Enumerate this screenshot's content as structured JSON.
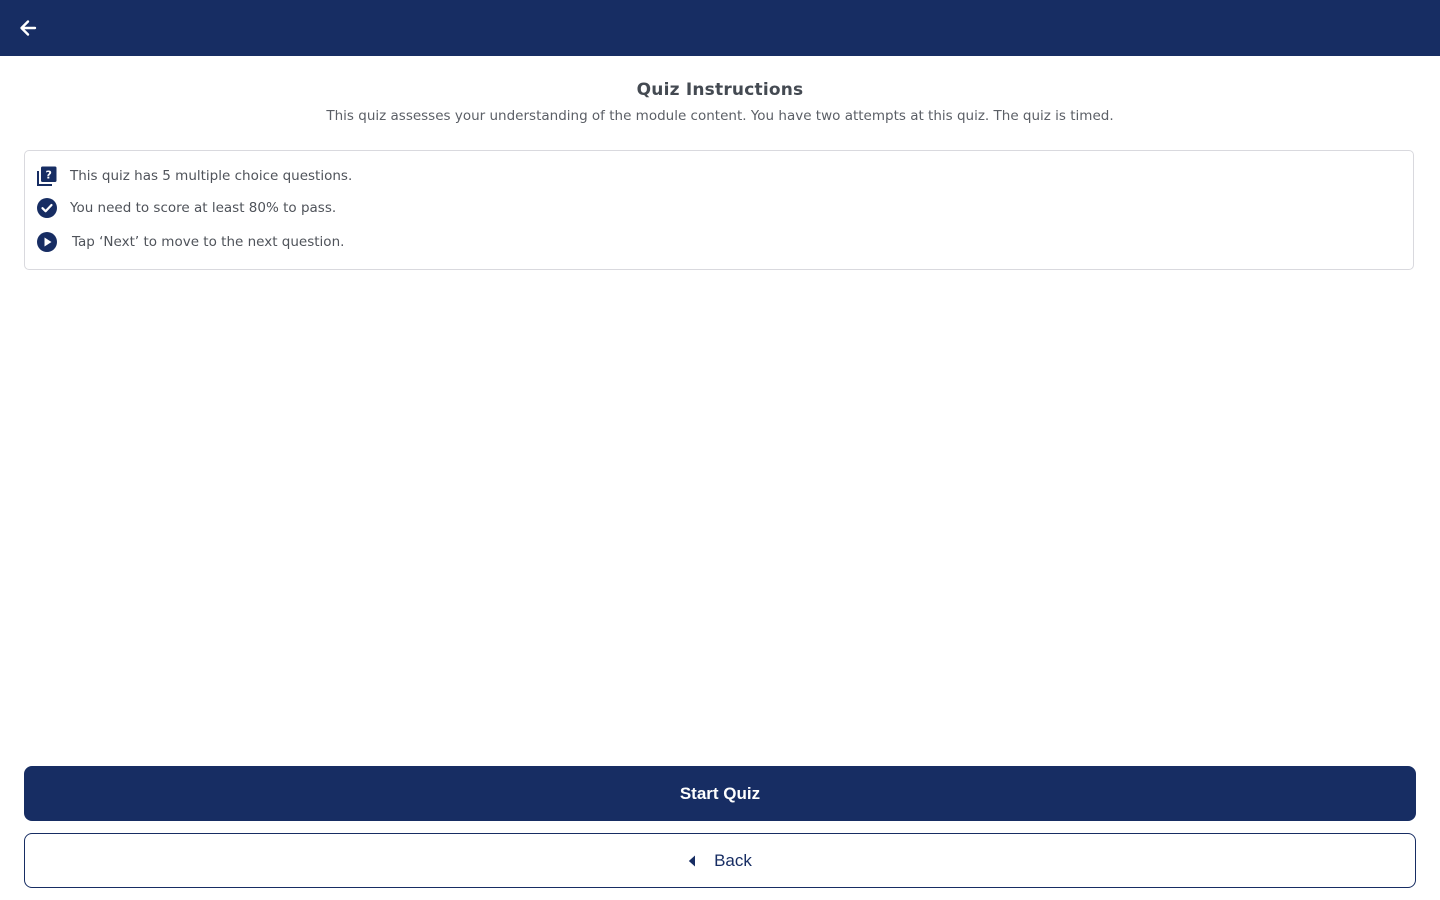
{
  "app_bar": {
    "back_icon": "arrow-left-icon",
    "color": "#172d63"
  },
  "header": {
    "title": "Quiz Instructions",
    "subtitle": "This quiz assesses your understanding of the module content. You have two attempts at this quiz. The quiz is timed."
  },
  "instructions": [
    {
      "icon": "quiz-questions-icon",
      "text": "This quiz has 5 multiple choice questions."
    },
    {
      "icon": "check-circle-icon",
      "text": "You need to score at least 80% to pass."
    },
    {
      "icon": "play-circle-icon",
      "text": "Tap ‘Next’ to move to the next question."
    }
  ],
  "actions": {
    "start_label": "Start Quiz",
    "back_label": "Back",
    "back_icon": "caret-left-icon"
  }
}
